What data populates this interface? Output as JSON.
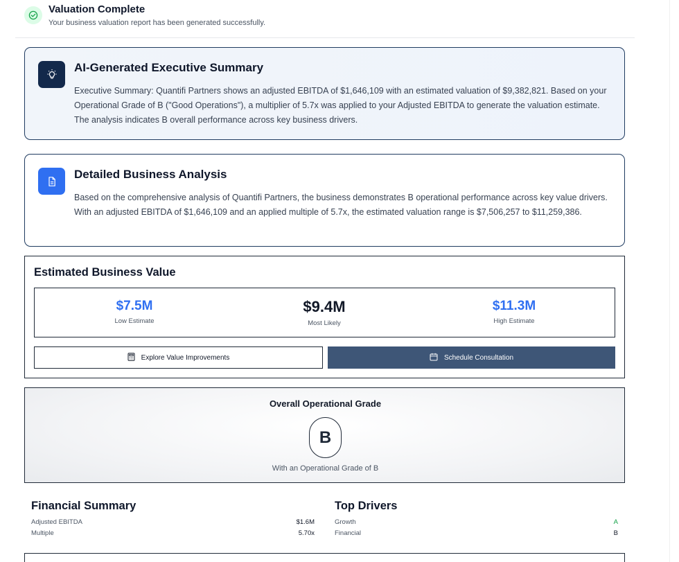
{
  "header": {
    "title": "Valuation Complete",
    "subtitle": "Your business valuation report has been generated successfully."
  },
  "executive_summary": {
    "title": "AI-Generated Executive Summary",
    "body": "Executive Summary: Quantifi Partners shows an adjusted EBITDA of $1,646,109 with an estimated valuation of $9,382,821. Based on your Operational Grade of B (\"Good Operations\"), a multiplier of 5.7x was applied to your Adjusted EBITDA to generate the valuation estimate. The analysis indicates B overall performance across key business drivers.",
    "icon": "lightbulb-icon"
  },
  "detailed_analysis": {
    "title": "Detailed Business Analysis",
    "body": "Based on the comprehensive analysis of Quantifi Partners, the business demonstrates B operational performance across key value drivers. With an adjusted EBITDA of $1,646,109 and an applied multiple of 5.7x, the estimated valuation range is $7,506,257 to $11,259,386.",
    "icon": "document-icon"
  },
  "estimated_value": {
    "title": "Estimated Business Value",
    "low": {
      "value": "$7.5M",
      "label": "Low Estimate"
    },
    "mid": {
      "value": "$9.4M",
      "label": "Most Likely"
    },
    "high": {
      "value": "$11.3M",
      "label": "High Estimate"
    },
    "explore_label": "Explore Value Improvements",
    "schedule_label": "Schedule Consultation"
  },
  "grade": {
    "title": "Overall Operational Grade",
    "letter": "B",
    "subtitle": "With an Operational Grade of B"
  },
  "financial_summary": {
    "title": "Financial Summary",
    "rows": [
      {
        "label": "Adjusted EBITDA",
        "value": "$1.6M"
      },
      {
        "label": "Multiple",
        "value": "5.70x"
      }
    ]
  },
  "top_drivers": {
    "title": "Top Drivers",
    "rows": [
      {
        "label": "Growth",
        "value": "A"
      },
      {
        "label": "Financial",
        "value": "B"
      }
    ]
  },
  "colors": {
    "accent_blue": "#2f6ff1",
    "navy": "#13294b",
    "button_slate": "#3e5677",
    "success_green": "#16a34a"
  }
}
